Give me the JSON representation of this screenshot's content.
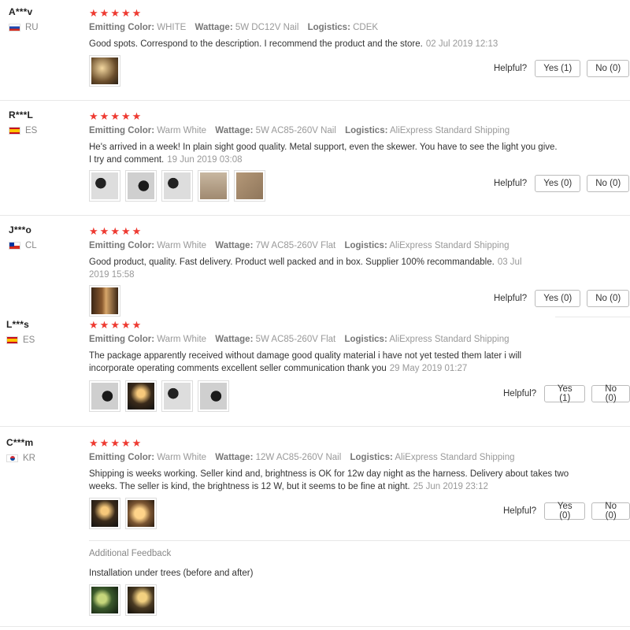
{
  "reviews": [
    {
      "user": "A***v",
      "country": "RU",
      "flag": "ru",
      "stars": 5,
      "color_label": "Emitting Color:",
      "color": "WHITE",
      "wattage_label": "Wattage:",
      "wattage": "5W DC12V Nail",
      "logistics_label": "Logistics:",
      "logistics": "CDEK",
      "text": "Good spots. Correspond to the description. I recommend the product and the store.",
      "date": "02 Jul 2019 12:13",
      "helpful_label": "Helpful?",
      "yes": "Yes (1)",
      "no": "No (0)"
    },
    {
      "user": "R***L",
      "country": "ES",
      "flag": "es",
      "stars": 5,
      "color_label": "Emitting Color:",
      "color": "Warm White",
      "wattage_label": "Wattage:",
      "wattage": "5W AC85-260V Nail",
      "logistics_label": "Logistics:",
      "logistics": "AliExpress Standard Shipping",
      "text": "He's arrived in a week! In plain sight good quality. Metal support, even the skewer. You have to see the light you give. I try and comment.",
      "date": "19 Jun 2019 03:08",
      "helpful_label": "Helpful?",
      "yes": "Yes (0)",
      "no": "No (0)"
    },
    {
      "user": "J***o",
      "country": "CL",
      "flag": "cl",
      "stars": 5,
      "color_label": "Emitting Color:",
      "color": "Warm White",
      "wattage_label": "Wattage:",
      "wattage": "7W AC85-260V Flat",
      "logistics_label": "Logistics:",
      "logistics": "AliExpress Standard Shipping",
      "text": "Good product, quality. Fast delivery. Product well packed and in box. Supplier 100% recommandable.",
      "date": "03 Jul 2019 15:58",
      "helpful_label": "Helpful?",
      "yes": "Yes (0)",
      "no": "No (0)"
    },
    {
      "user": "L***s",
      "country": "ES",
      "flag": "es",
      "stars": 5,
      "color_label": "Emitting Color:",
      "color": "Warm White",
      "wattage_label": "Wattage:",
      "wattage": "5W AC85-260V Flat",
      "logistics_label": "Logistics:",
      "logistics": "AliExpress Standard Shipping",
      "text": "The package apparently received without damage good quality material i have not yet tested them later i will incorporate operating comments excellent seller communication thank you",
      "date": "29 May 2019 01:27",
      "helpful_label": "Helpful?",
      "yes": "Yes (1)",
      "no": "No (0)"
    },
    {
      "user": "C***m",
      "country": "KR",
      "flag": "kr",
      "stars": 5,
      "color_label": "Emitting Color:",
      "color": "Warm White",
      "wattage_label": "Wattage:",
      "wattage": "12W AC85-260V Nail",
      "logistics_label": "Logistics:",
      "logistics": "AliExpress Standard Shipping",
      "text": "Shipping is weeks working. Seller kind and, brightness is OK for 12w day night as the harness. Delivery about takes two weeks. The seller is kind, the brightness is 12 W, but it seems to be fine at night.",
      "date": "25 Jun 2019 23:12",
      "helpful_label": "Helpful?",
      "yes": "Yes (0)",
      "no": "No (0)",
      "additional_title": "Additional Feedback",
      "additional_text": "Installation under trees (before and after)"
    }
  ],
  "star_glyph": "★",
  "accent_color": "#ee3a31"
}
